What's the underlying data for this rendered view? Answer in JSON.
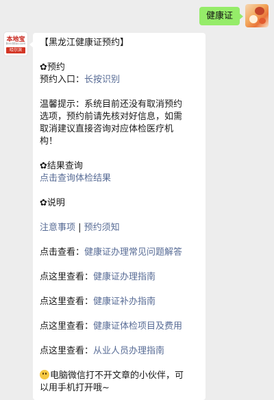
{
  "user_message": {
    "text": "健康证"
  },
  "bot_avatar": {
    "name": "本地宝",
    "sub": "BendiBao.com",
    "city": "哈尔滨"
  },
  "message": {
    "title": "【黑龙江健康证预约】",
    "booking_heading": "✿预约",
    "booking_entry_label": "预约入口：",
    "booking_entry_link": "长按识别",
    "tip_line1": "温馨提示：系统目前还没有取消预约",
    "tip_line2": "选项，预约前请先核对好信息，如需",
    "tip_line3": "取消建议直接咨询对应体检医疗机",
    "tip_line4": "构！",
    "result_heading": "✿结果查询",
    "result_link": "点击查询体检结果",
    "notes_heading": "✿说明",
    "notes_link1": "注意事项",
    "notes_sep": " | ",
    "notes_link2": "预约须知",
    "faq_prefix": "点击查看：",
    "faq_link": "健康证办理常见问题解答",
    "guide_prefix": "点这里查看：",
    "guide_link": "健康证办理指南",
    "reissue_prefix": "点这里查看：",
    "reissue_link": "健康证补办指南",
    "items_prefix": "点这里查看：",
    "items_link": "健康证体检项目及费用",
    "staff_prefix": "点这里查看：",
    "staff_link": "从业人员办理指南",
    "footer_line1": "电脑微信打不开文章的小伙伴，可",
    "footer_line2": "以用手机打开哦~"
  },
  "colors": {
    "user_bubble": "#95ec69",
    "link": "#576b95",
    "background": "#ededed"
  }
}
